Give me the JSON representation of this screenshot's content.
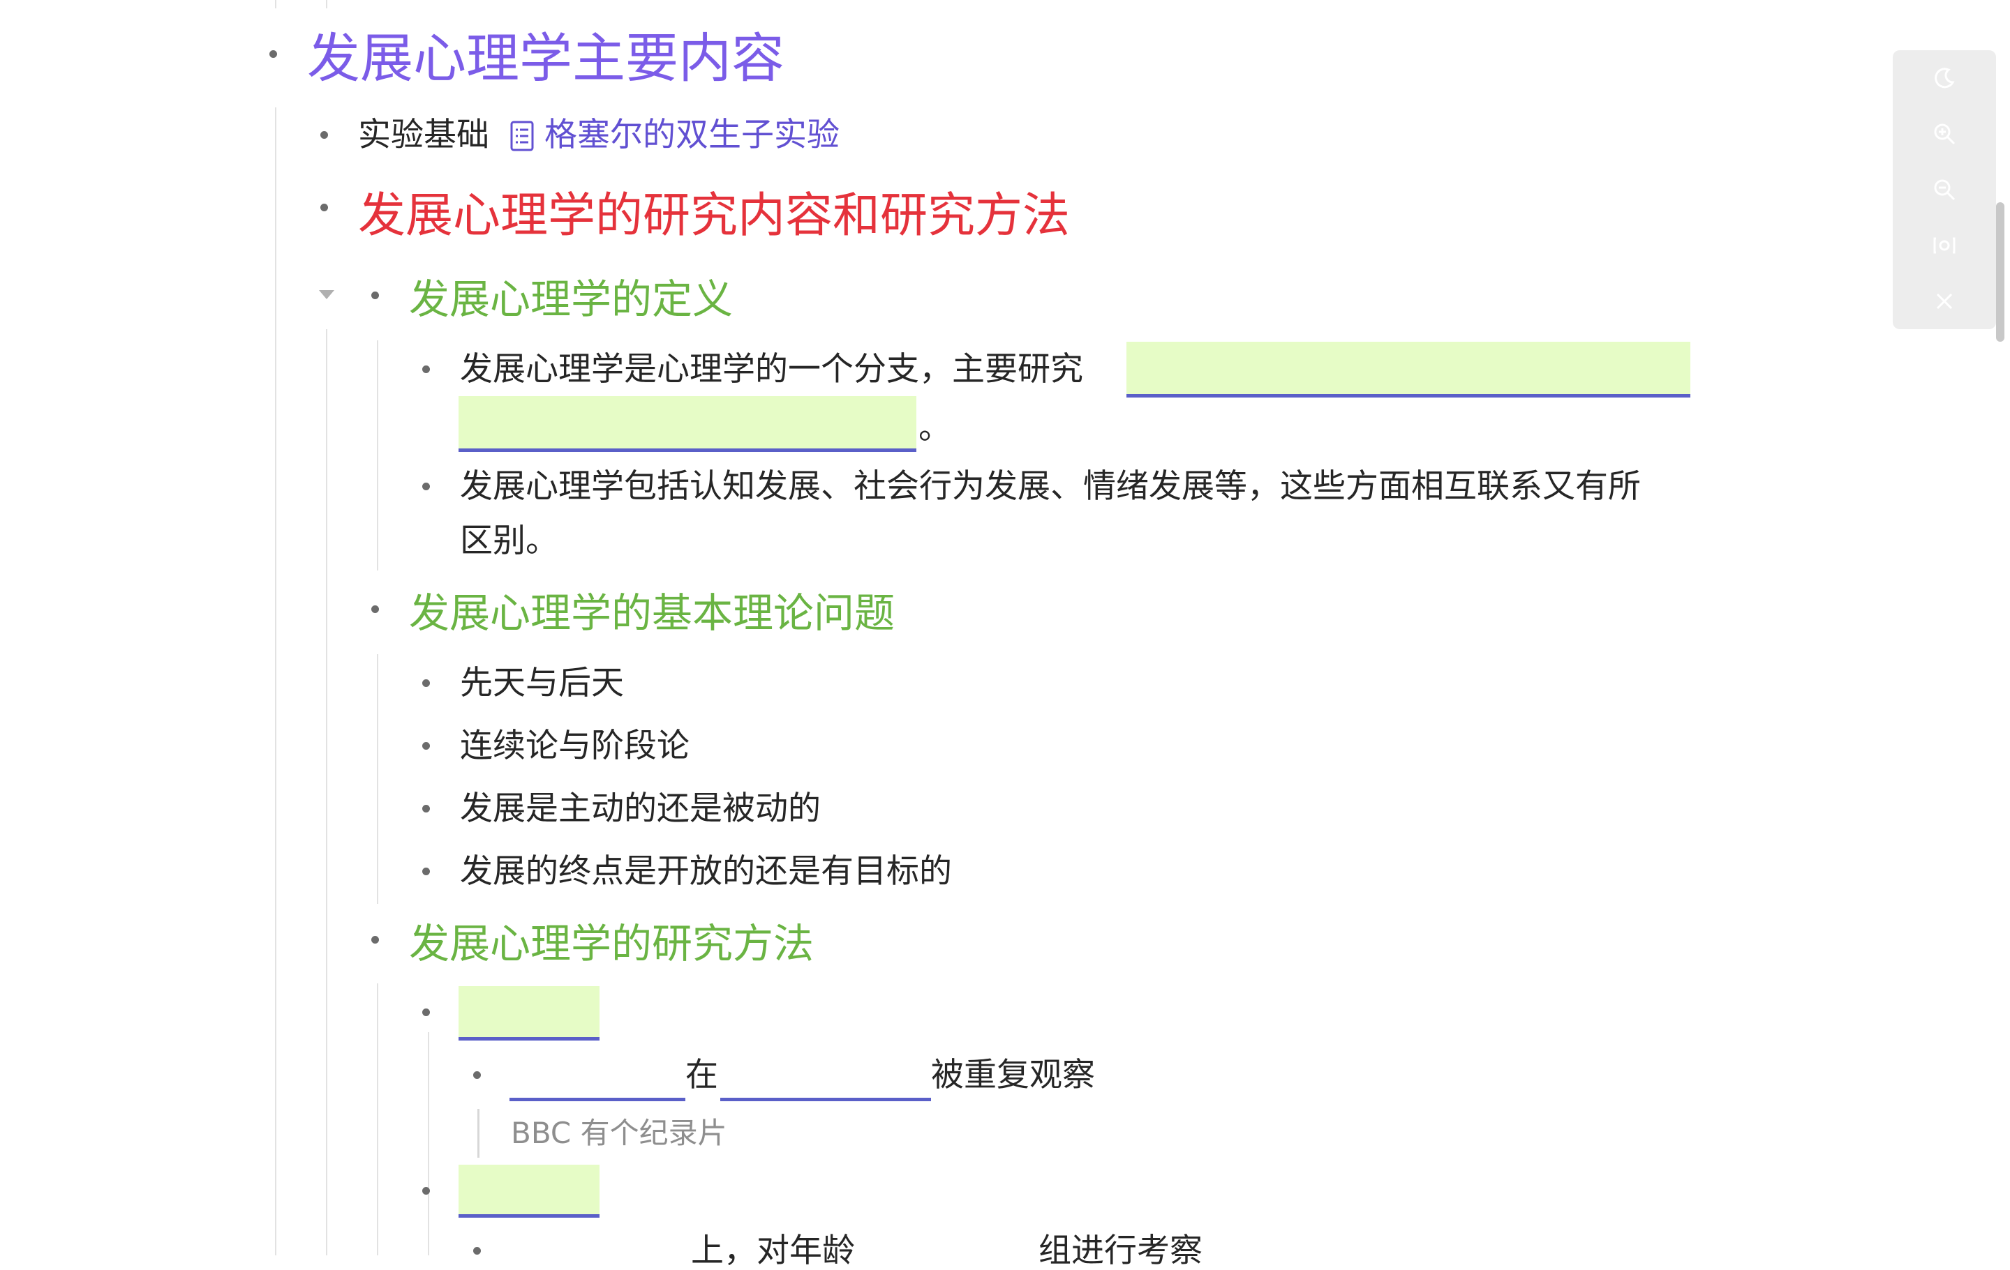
{
  "outline": {
    "h1": "发展心理学主要内容",
    "experiment_prefix": "实验基础",
    "experiment_link": "格塞尔的双生子实验",
    "h2": "发展心理学的研究内容和研究方法",
    "section_definition": {
      "title": "发展心理学的定义",
      "item1_text": "发展心理学是心理学的一个分支，主要研究",
      "item1_end": "。",
      "item2_line1": "发展心理学包括认知发展、社会行为发展、情绪发展等，这些方面相互联系又有所",
      "item2_line2": "区别。"
    },
    "section_theory": {
      "title": "发展心理学的基本理论问题",
      "items": [
        "先天与后天",
        "连续论与阶段论",
        "发展是主动的还是被动的",
        "发展的终点是开放的还是有目标的"
      ]
    },
    "section_method": {
      "title": "发展心理学的研究方法",
      "sub1_mid": "在",
      "sub1_end": "被重复观察",
      "note": "BBC 有个纪录片",
      "sub2_a": "上，对年龄",
      "sub2_b": "组进行考察"
    }
  },
  "toolbar": {
    "icons": [
      "moon-icon",
      "zoom-in-icon",
      "zoom-out-icon",
      "focus-icon",
      "close-icon"
    ]
  },
  "colors": {
    "h1": "#7b5ce8",
    "h2": "#e5323b",
    "h3": "#6ab443",
    "link": "#6150d2",
    "cloze_fill": "#e6fcc6",
    "cloze_underline": "#5a5fc8"
  }
}
